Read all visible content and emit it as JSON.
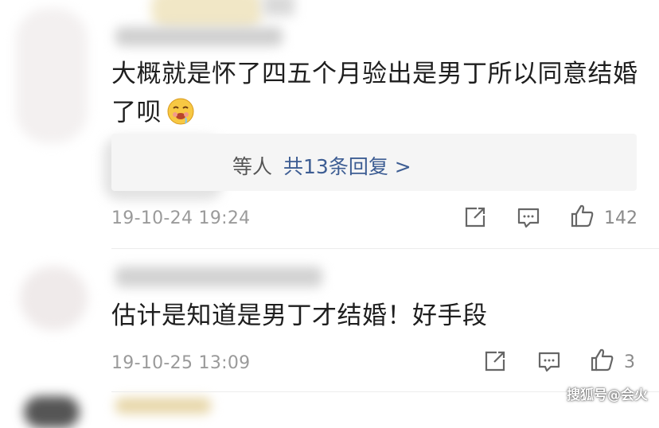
{
  "comments": [
    {
      "text_line1": "大概就是怀了四五个月验出是男丁所以同意结婚",
      "text_line2": "了呗",
      "emoji": "drooling-face-emoji",
      "reply_suffix": "等人",
      "reply_link": "共13条回复 >",
      "timestamp": "19-10-24 19:24",
      "like_count": "142"
    },
    {
      "text": "估计是知道是男丁才结婚！好手段",
      "timestamp": "19-10-25 13:09",
      "like_count": "3"
    }
  ],
  "icons": [
    "share-icon",
    "comment-icon",
    "like-icon"
  ],
  "watermark": "搜狐号@会火",
  "colors": {
    "link": "#3d5d93",
    "meta": "#9a9a9a",
    "reply_bg": "#f5f5f5"
  }
}
